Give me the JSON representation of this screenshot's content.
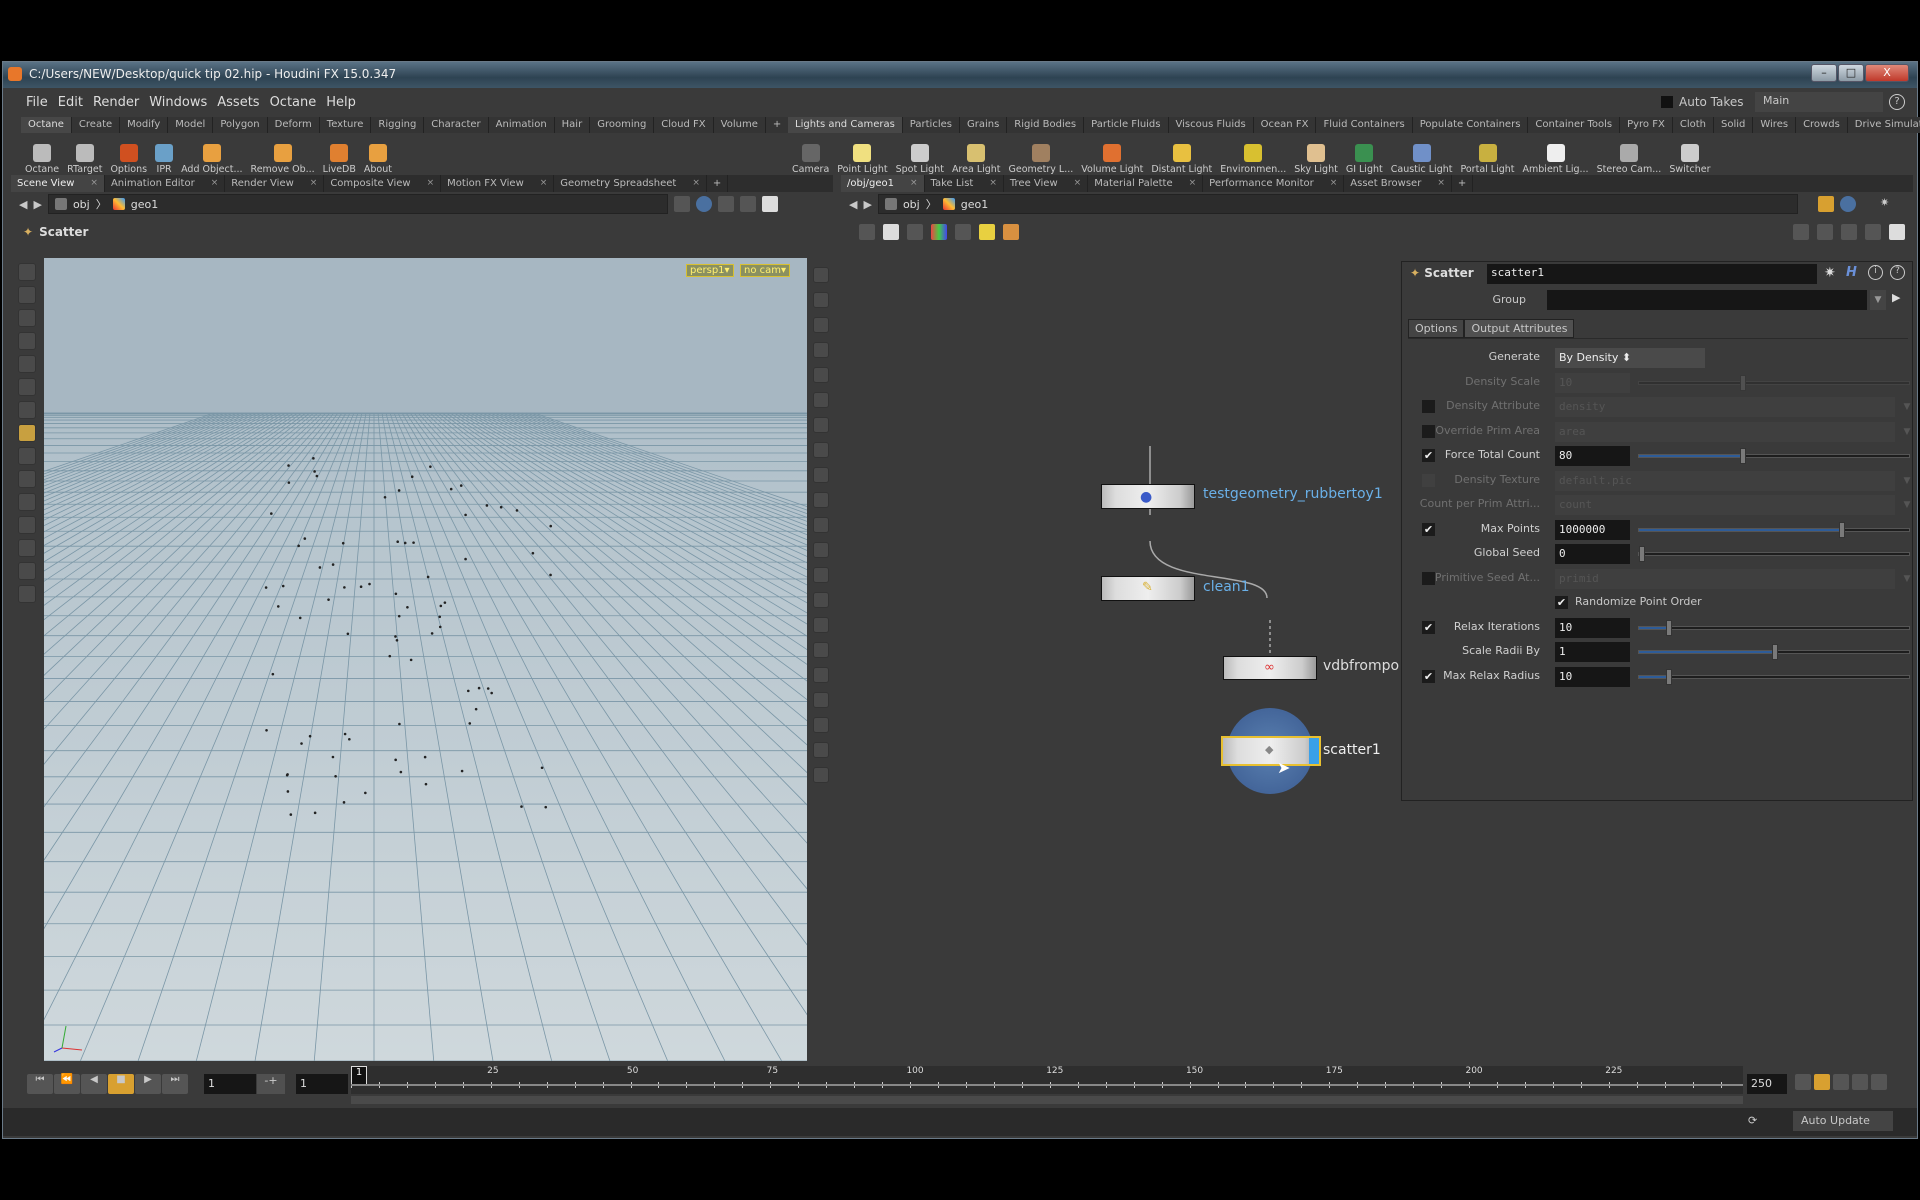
{
  "window": {
    "title": "C:/Users/NEW/Desktop/quick tip 02.hip - Houdini FX 15.0.347",
    "min": "–",
    "max": "□",
    "close": "X"
  },
  "menu": [
    "File",
    "Edit",
    "Render",
    "Windows",
    "Assets",
    "Octane",
    "Help"
  ],
  "auto_takes": "Auto Takes",
  "desktop": "Main",
  "left_shelf": {
    "tabs": [
      "Octane",
      "Create",
      "Modify",
      "Model",
      "Polygon",
      "Deform",
      "Texture",
      "Rigging",
      "Character",
      "Animation",
      "Hair",
      "Grooming",
      "Cloud FX",
      "Volume"
    ],
    "tools": [
      "Octane",
      "RTarget",
      "Options",
      "IPR",
      "Add Object...",
      "Remove Ob...",
      "LiveDB",
      "About"
    ]
  },
  "right_shelf": {
    "tabs": [
      "Lights and Cameras",
      "Particles",
      "Grains",
      "Rigid Bodies",
      "Particle Fluids",
      "Viscous Fluids",
      "Ocean FX",
      "Fluid Containers",
      "Populate Containers",
      "Container Tools",
      "Pyro FX",
      "Cloth",
      "Solid",
      "Wires",
      "Crowds",
      "Drive Simulation"
    ],
    "tools": [
      "Camera",
      "Point Light",
      "Spot Light",
      "Area Light",
      "Geometry L...",
      "Volume Light",
      "Distant Light",
      "Environmen...",
      "Sky Light",
      "GI Light",
      "Caustic Light",
      "Portal Light",
      "Ambient Lig...",
      "Stereo Cam...",
      "Switcher"
    ]
  },
  "left_pane": {
    "tabs": [
      "Scene View",
      "Animation Editor",
      "Render View",
      "Composite View",
      "Motion FX View",
      "Geometry Spreadsheet"
    ],
    "path": [
      "obj",
      "geo1"
    ],
    "header": "Scatter",
    "camera": "persp1▾",
    "cam_menu": "no cam▾"
  },
  "right_pane": {
    "tabs": [
      "/obj/geo1",
      "Take List",
      "Tree View",
      "Material Palette",
      "Performance Monitor",
      "Asset Browser"
    ],
    "path": [
      "obj",
      "geo1"
    ]
  },
  "nodes": [
    {
      "name": "testgeometry_rubbertoy1"
    },
    {
      "name": "clean1"
    },
    {
      "name": "vdbfrompo"
    },
    {
      "name": "scatter1"
    }
  ],
  "params": {
    "type": "Scatter",
    "name": "scatter1",
    "group_label": "Group",
    "group_value": "",
    "tabs": [
      "Options",
      "Output Attributes"
    ],
    "generate": {
      "label": "Generate",
      "value": "By Density"
    },
    "density_scale": {
      "label": "Density Scale",
      "value": "10"
    },
    "density_attribute": {
      "label": "Density Attribute",
      "value": "density",
      "checked": false
    },
    "override_prim_area": {
      "label": "Override Prim Area",
      "value": "area",
      "checked": false
    },
    "force_total_count": {
      "label": "Force Total Count",
      "value": "80",
      "checked": true,
      "slider": 0.38
    },
    "density_texture": {
      "label": "Density Texture",
      "value": "default.pic"
    },
    "count_per_prim": {
      "label": "Count per Prim Attri...",
      "value": "count"
    },
    "max_points": {
      "label": "Max Points",
      "value": "1000000",
      "checked": true,
      "slider": 0.75
    },
    "global_seed": {
      "label": "Global Seed",
      "value": "0",
      "slider": 0
    },
    "primitive_seed": {
      "label": "Primitive Seed At...",
      "value": "primid",
      "checked": false
    },
    "randomize": {
      "label": "Randomize Point Order",
      "checked": true
    },
    "relax_iterations": {
      "label": "Relax Iterations",
      "value": "10",
      "checked": true,
      "slider": 0.1
    },
    "scale_radii": {
      "label": "Scale Radii By",
      "value": "1",
      "slider": 0.5
    },
    "max_relax_radius": {
      "label": "Max Relax Radius",
      "value": "10",
      "checked": true,
      "slider": 0.1
    }
  },
  "timeline": {
    "frame": "1",
    "start": "1",
    "range_start": "1",
    "end": "250",
    "current": "1",
    "ticks": [
      "25",
      "50",
      "75",
      "100",
      "125",
      "150",
      "175",
      "200",
      "225"
    ]
  },
  "status": {
    "auto_update": "Auto Update"
  },
  "check": "✔"
}
